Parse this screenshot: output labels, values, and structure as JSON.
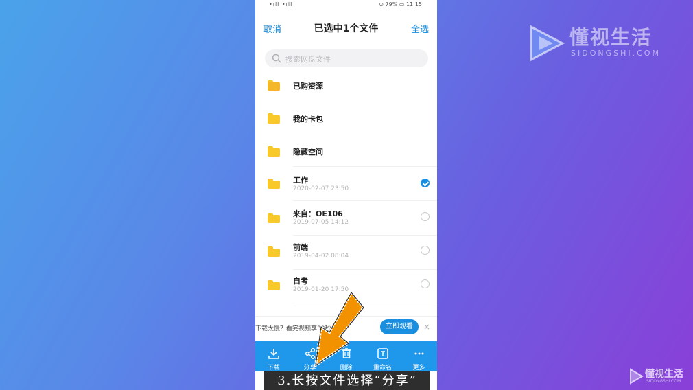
{
  "status_bar": {
    "left": "•ıll •ıll",
    "right": "⊙ 79% ▭ 11:15"
  },
  "header": {
    "cancel": "取消",
    "title": "已选中1个文件",
    "select_all": "全选"
  },
  "search": {
    "placeholder": "搜索网盘文件"
  },
  "files": [
    {
      "name": "已购资源"
    },
    {
      "name": "我的卡包"
    },
    {
      "name": "隐藏空间"
    },
    {
      "name": "工作",
      "date": "2020-02-07 23:50",
      "checked": true
    },
    {
      "name": "来自：OE106",
      "date": "2019-07-05 14:12",
      "checked": false
    },
    {
      "name": "前端",
      "date": "2019-04-02 08:04",
      "checked": false
    },
    {
      "name": "自考",
      "date": "2019-01-20 17:50",
      "checked": false
    }
  ],
  "promo": {
    "text": "下载太慢？看完视频享30秒加速",
    "button": "立即观看",
    "close": "×"
  },
  "toolbar": {
    "download": "下载",
    "share": "分享",
    "delete": "删除",
    "rename": "重命名",
    "more": "更多"
  },
  "caption": "3.长按文件选择“分享”",
  "watermark": {
    "title": "懂视生活",
    "subtitle": "SIDONGSHI.COM"
  },
  "watermark_small": {
    "title": "懂视生活",
    "subtitle": "SIDONGSHI.COM"
  },
  "colors": {
    "accent": "#1a8fe0",
    "toolbar": "#1f97ea",
    "arrow": "#f39200"
  }
}
